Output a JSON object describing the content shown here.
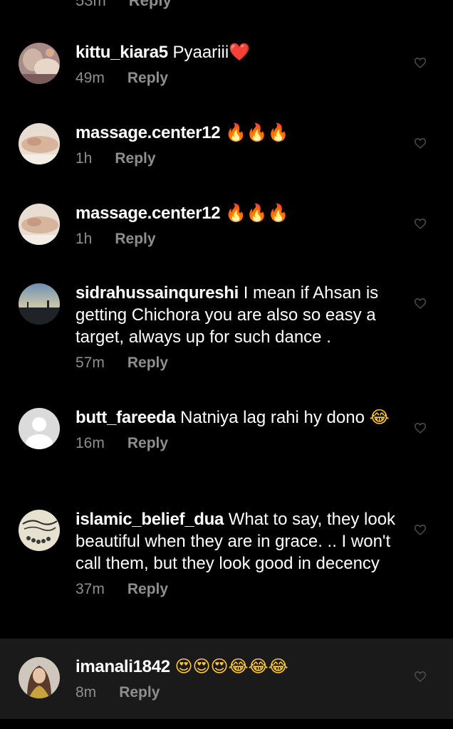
{
  "top_partial": {
    "time": "53m",
    "reply_label": "Reply"
  },
  "comments": [
    {
      "username": "kittu_kiara5",
      "text": " Pyaariii",
      "emoji": "❤️",
      "time": "49m",
      "reply_label": "Reply"
    },
    {
      "username": "massage.center12",
      "text": " ",
      "emoji": "🔥🔥🔥",
      "time": "1h",
      "reply_label": "Reply"
    },
    {
      "username": "massage.center12",
      "text": " ",
      "emoji": "🔥🔥🔥",
      "time": "1h",
      "reply_label": "Reply"
    },
    {
      "username": "sidrahussainqureshi",
      "text": " I mean if Ahsan is getting Chichora you are also so easy a target, always up for such dance .",
      "emoji": "",
      "time": "57m",
      "reply_label": "Reply"
    },
    {
      "username": "butt_fareeda",
      "text": " Natniya lag rahi hy dono ",
      "emoji": "😂",
      "time": "16m",
      "reply_label": "Reply"
    },
    {
      "username": "islamic_belief_dua",
      "text": " What to say, they look beautiful when they are in grace. .. I won't call them, but they look good in decency",
      "emoji": "",
      "time": "37m",
      "reply_label": "Reply"
    },
    {
      "username": "imanali1842",
      "text": " ",
      "emoji": "😍😍😍😂😂😂",
      "time": "8m",
      "reply_label": "Reply"
    }
  ],
  "colors": {
    "background": "#000000",
    "highlight_background": "#1a1a1a",
    "primary_text": "#ffffff",
    "secondary_text": "#8e8e8e",
    "heart_outline": "#555555"
  },
  "icons": {
    "like": "heart-outline-icon",
    "avatar_default": "default-user-icon"
  }
}
